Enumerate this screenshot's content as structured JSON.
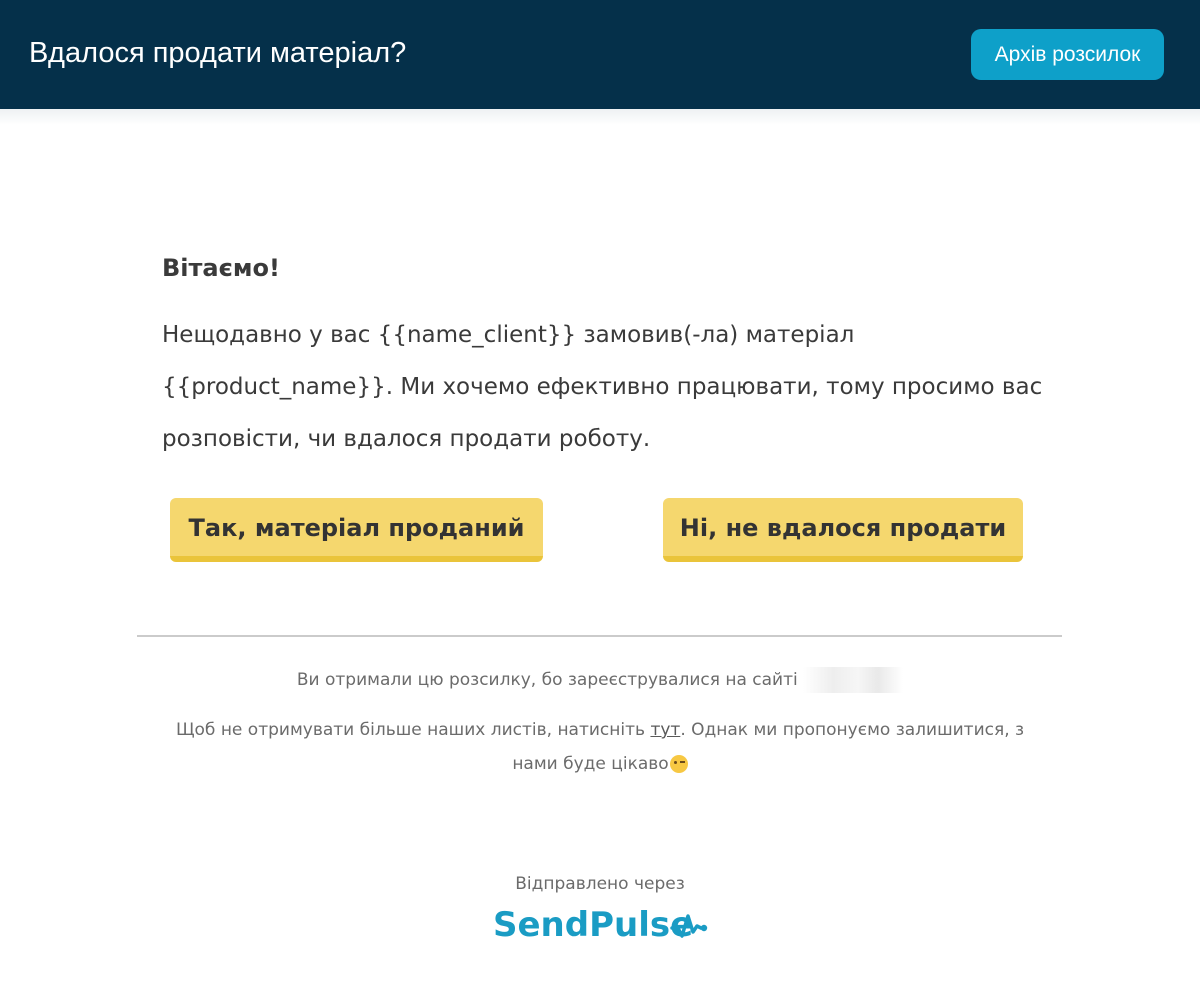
{
  "header": {
    "title": "Вдалося продати матеріал?",
    "archive_button": "Архів розсилок"
  },
  "colors": {
    "header_bg": "#05304a",
    "archive_button_bg": "#0ea0c9",
    "cta_button_bg": "#f5d76e",
    "brand": "#1a9cc4"
  },
  "email": {
    "greeting": "Вітаємо!",
    "body_lines": [
      "Нещодавно у вас {{name_client}} замовив(-ла) матеріал",
      "{{product_name}}. Ми хочемо ефективно працювати, тому просимо вас",
      "розповісти, чи вдалося продати роботу."
    ],
    "yes_button": "Так, матеріал проданий",
    "no_button": "Ні, не вдалося продати"
  },
  "footer": {
    "registered_text": "Ви отримали цю розсилку, бо зареєструвалися на сайті",
    "unsubscribe_prefix": "Щоб не отримувати більше наших листів, натисніть",
    "unsubscribe_link": "тут",
    "unsubscribe_suffix": ". Однак ми пропонуємо залишитися, з",
    "unsubscribe_line2": "нами буде цікаво",
    "wink_emoji": "😉",
    "sent_via": "Відправлено через",
    "logo_text": "SendPulse",
    "logo_icon": "pulse-icon"
  }
}
